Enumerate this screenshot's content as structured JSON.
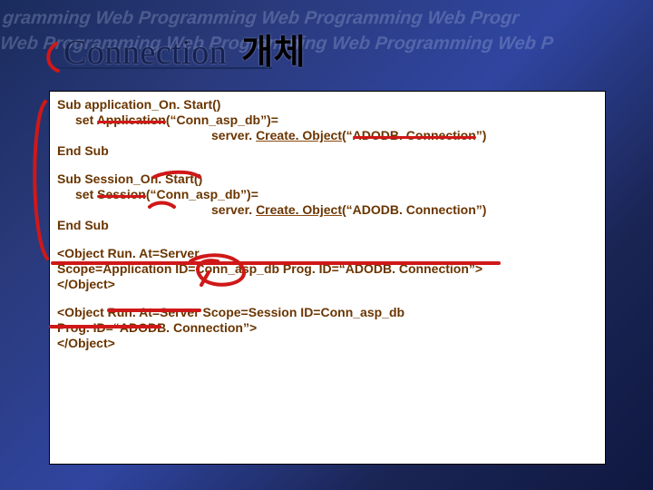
{
  "background_watermark": "gramming Web Programming Web Programming Web Progr",
  "background_watermark2": "Web Programming Web Programming Web Programming Web P",
  "title": {
    "eng": "Connection",
    "kor": "개체"
  },
  "colors": {
    "title_navy": "#1a2b5c",
    "code_brown": "#6a3500",
    "anno_red": "#d01818"
  },
  "code": {
    "b1_l1": "Sub application_On. Start()",
    "b1_l2_pre": "set ",
    "b1_l2_strike": "Application",
    "b1_l2_post": "(“Conn_asp_db”)=",
    "b1_l3_pre": "server. ",
    "b1_l3_u": "Create. Object",
    "b1_l3_post_a": "(“",
    "b1_l3_strike2": "ADODB. Connection",
    "b1_l3_post_b": "”)",
    "b1_l4": "End Sub",
    "b2_l1": "Sub Session_On. Start()",
    "b2_l2_pre": "set ",
    "b2_l2_strike": "Session",
    "b2_l2_post": "(“Conn_asp_db”)=",
    "b2_l3_pre": "server. ",
    "b2_l3_u": "Create. Object",
    "b2_l3_post": "(“ADODB. Connection”)",
    "b2_l4": "End Sub",
    "b3_l1": "<Object Run. At=Server",
    "b3_l2": " Scope=Application ID=Conn_asp_db Prog. ID=“ADODB. Connection”>",
    "b3_l3": "</Object>",
    "b4_l1": "<Object Run. At=Server Scope=Session ID=Conn_asp_db",
    "b4_l2": "Prog. ID=“ADODB. Connection”>",
    "b4_l3": "</Object>"
  }
}
